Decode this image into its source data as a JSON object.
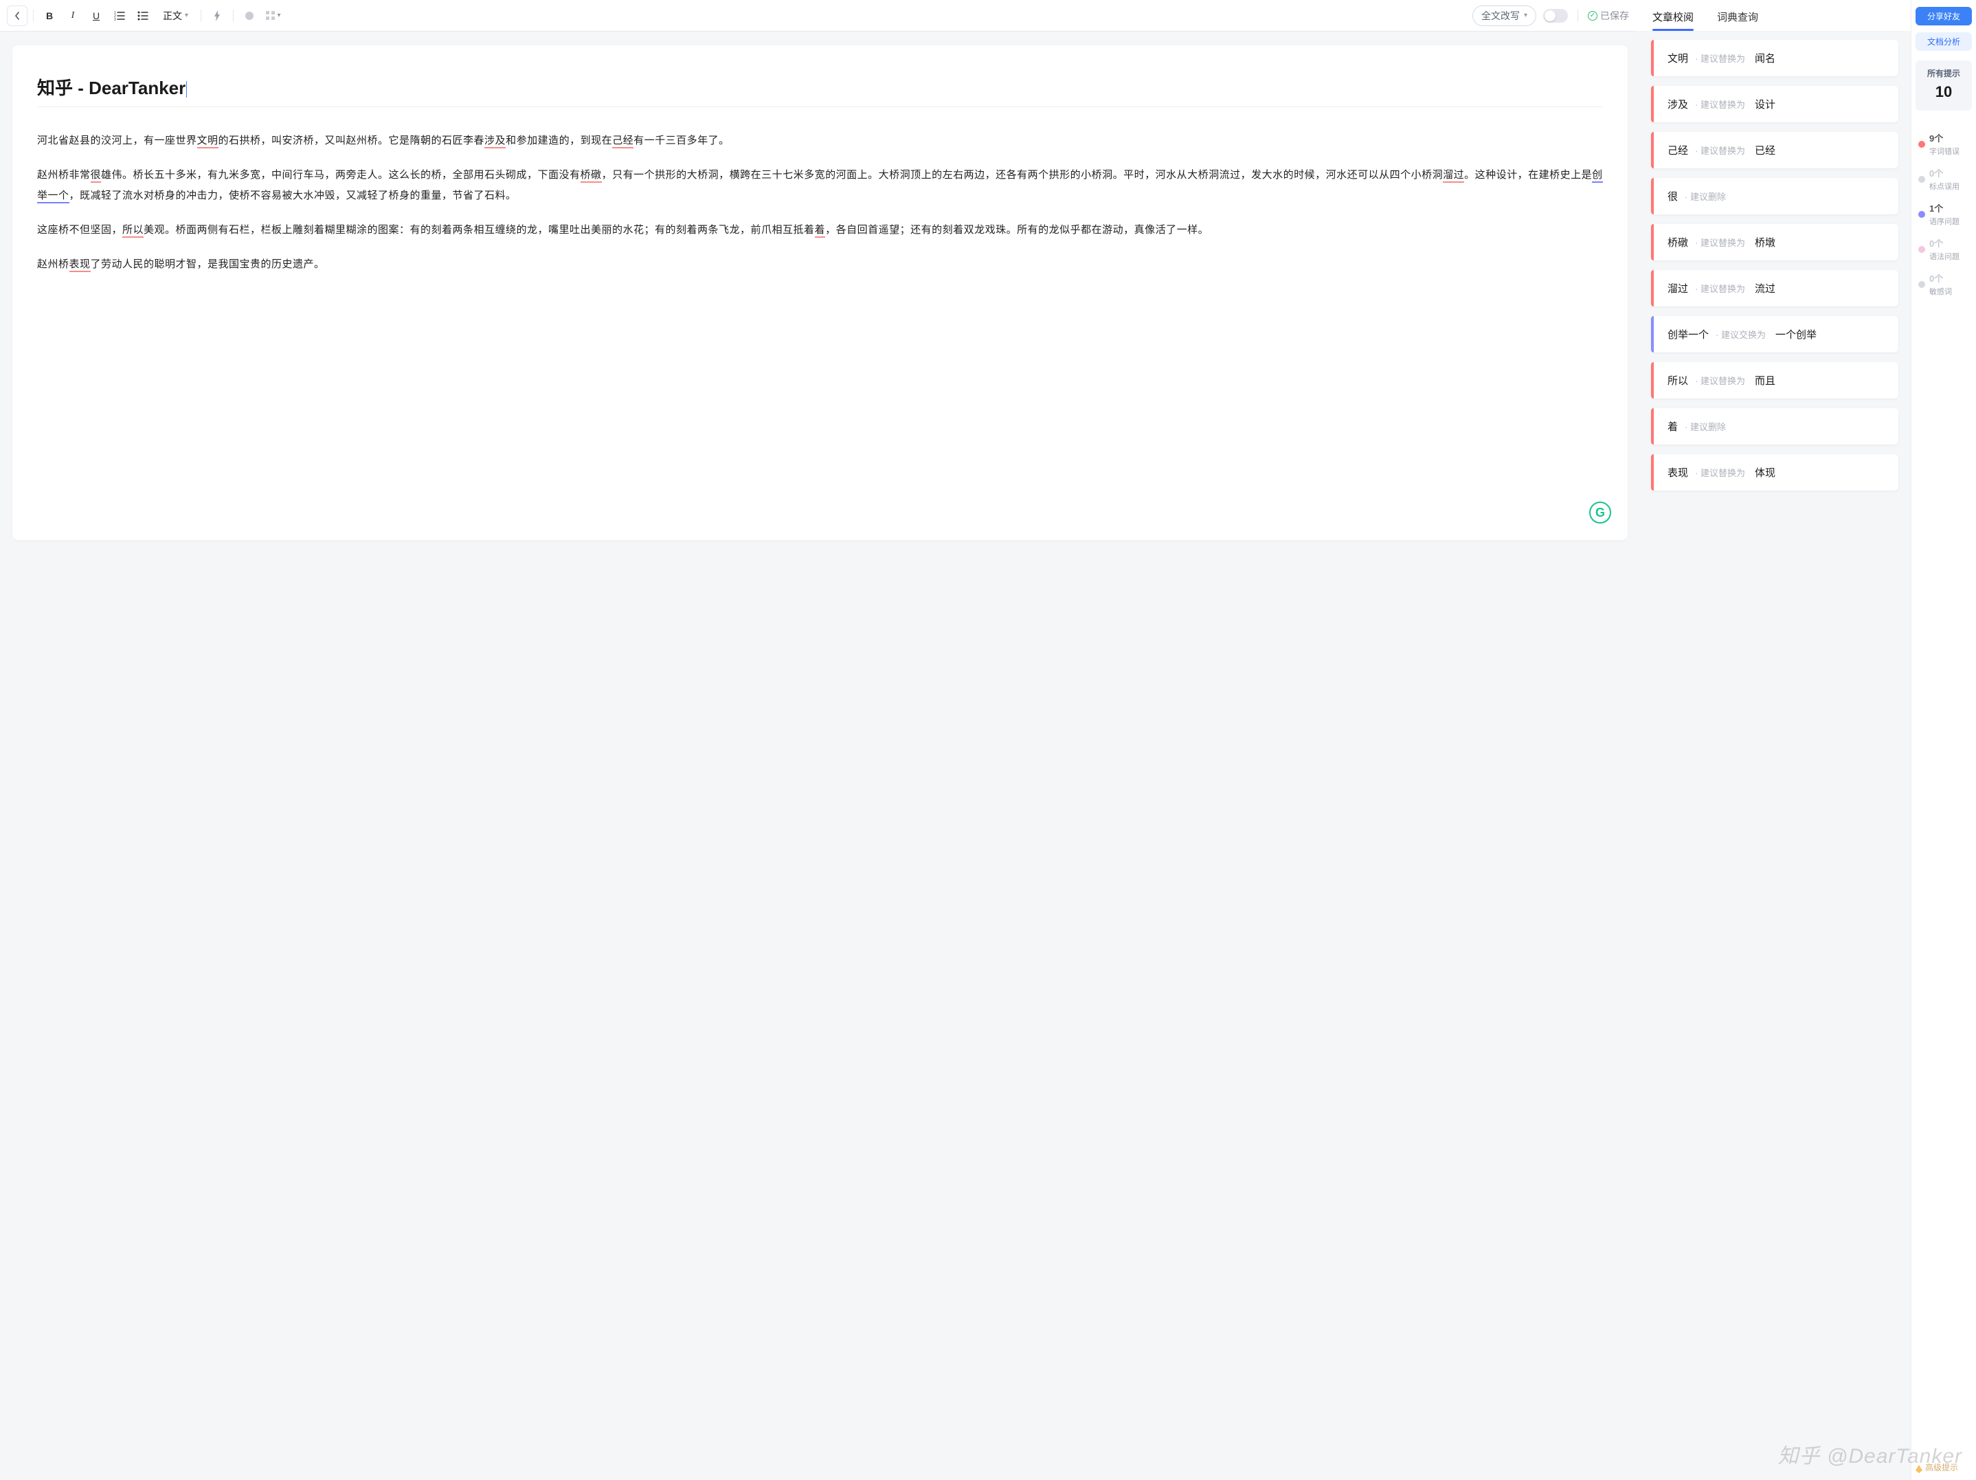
{
  "toolbar": {
    "back_icon": "chevron-left",
    "style_label": "正文",
    "rewrite_label": "全文改写",
    "saved_label": "已保存",
    "icons": [
      "bold",
      "italic",
      "underline",
      "ordered-list",
      "unordered-list",
      "style",
      "lightning",
      "circle",
      "grid"
    ]
  },
  "mid_tabs": {
    "proofread": "文章校阅",
    "dictionary": "词典查询",
    "active": "proofread"
  },
  "doc": {
    "title": "知乎 - DearTanker",
    "p1_a": "河北省赵县的洨河上，有一座世界",
    "p1_u1": "文明",
    "p1_b": "的石拱桥，叫安济桥，又叫赵州桥。它是隋朝的石匠李春",
    "p2_u1": "涉及",
    "p2_a": "和参加建造的，到现在",
    "p2_u2": "己经",
    "p2_b": "有一千三百多年了。",
    "p3_a": "赵州桥非常",
    "p3_u1": "很",
    "p3_b": "雄伟。桥长五十多米，有九米多宽，中间行车马，两旁走人。这么长的桥，全部用石头砌成，下面没有",
    "p3_u2": "桥礅",
    "p3_c": "，只有一个拱形的大桥洞，横跨在三十七米多宽的河面上。大桥洞顶上的左右两边，还各有两个拱形的小桥洞。平时，河水从大桥洞流过，发大水的时候，河水还可以从四个小桥洞",
    "p3_u3": "溜过",
    "p3_d": "。这种设计，在建桥史上是",
    "p3_u4": "创举一个",
    "p3_e": "，既减轻了流水对桥身的冲击力，使桥不容易被大水冲毁，又减轻了桥身的重量，节省了石料。",
    "p4_a": "这座桥不但坚固，",
    "p4_u1": "所以",
    "p4_b": "美观。桥面两侧有石栏，栏板上雕刻着糊里糊涂的图案：有的刻着两条相互缠绕的龙，嘴里吐出美丽的水花；有的刻着两条飞龙，前爪相互抵着",
    "p4_u2": "着",
    "p4_c": "，各自回首遥望；还有的刻着双龙戏珠。所有的龙似乎都在游动，真像活了一样。",
    "p5_a": "赵州桥",
    "p5_u1": "表现",
    "p5_b": "了劳动人民的聪明才智，是我国宝贵的历史遗产。"
  },
  "suggestions": [
    {
      "color": "red",
      "word": "文明",
      "hint": "建议替换为",
      "rep": "闻名"
    },
    {
      "color": "red",
      "word": "涉及",
      "hint": "建议替换为",
      "rep": "设计"
    },
    {
      "color": "red",
      "word": "己经",
      "hint": "建议替换为",
      "rep": "已经"
    },
    {
      "color": "red",
      "word": "很",
      "hint": "建议删除",
      "rep": ""
    },
    {
      "color": "red",
      "word": "桥礅",
      "hint": "建议替换为",
      "rep": "桥墩"
    },
    {
      "color": "red",
      "word": "溜过",
      "hint": "建议替换为",
      "rep": "流过"
    },
    {
      "color": "purple",
      "word": "创举一个",
      "hint": "建议交换为",
      "rep": "一个创举"
    },
    {
      "color": "red",
      "word": "所以",
      "hint": "建议替换为",
      "rep": "而且"
    },
    {
      "color": "red",
      "word": "着",
      "hint": "建议删除",
      "rep": ""
    },
    {
      "color": "red",
      "word": "表现",
      "hint": "建议替换为",
      "rep": "体现"
    }
  ],
  "right": {
    "share_btn": "分享好友",
    "analyze_btn": "文档分析",
    "all_hints_label": "所有提示",
    "all_hints_count": "10",
    "cats": [
      {
        "dot": "#ff7676",
        "count": "9个",
        "label": "字词错误",
        "disabled": false
      },
      {
        "dot": "#d6d9e0",
        "count": "0个",
        "label": "标点误用",
        "disabled": true
      },
      {
        "dot": "#8a8cff",
        "count": "1个",
        "label": "语序问题",
        "disabled": false
      },
      {
        "dot": "#f3c7e0",
        "count": "0个",
        "label": "语法问题",
        "disabled": true
      },
      {
        "dot": "#d6d9e0",
        "count": "0个",
        "label": "敏感词",
        "disabled": true
      }
    ],
    "advanced_label": "高级提示"
  },
  "badge": "G",
  "watermark": "知乎 @DearTanker"
}
